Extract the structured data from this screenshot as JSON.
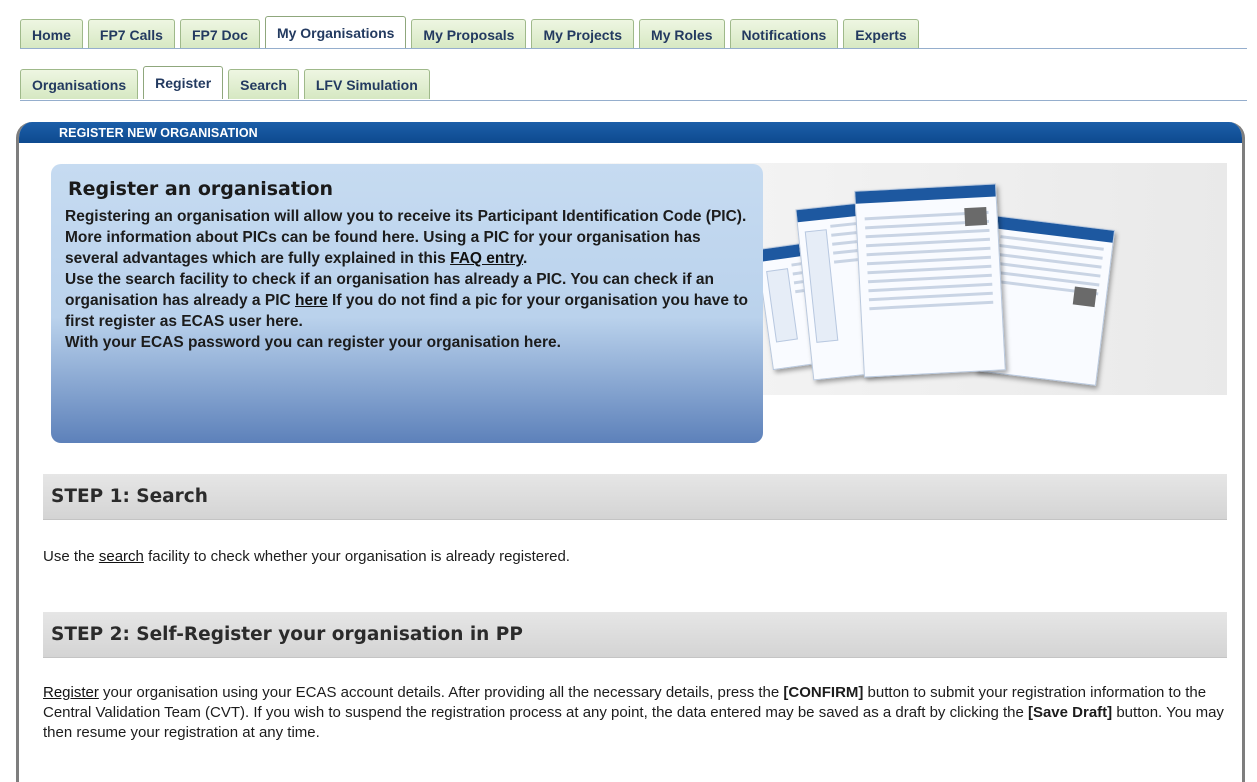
{
  "tabs": [
    "Home",
    "FP7 Calls",
    "FP7 Doc",
    "My Organisations",
    "My Proposals",
    "My Projects",
    "My Roles",
    "Notifications",
    "Experts"
  ],
  "subtabs": [
    "Organisations",
    "Register",
    "Search",
    "LFV Simulation"
  ],
  "panel": {
    "header": "REGISTER NEW ORGANISATION"
  },
  "infobox": {
    "title": "Register an organisation",
    "p1": "Registering an organisation will allow you to receive its Participant Identification Code (PIC).",
    "p2_pre": "More information about PICs can be found here. Using a PIC for your organisation has several advantages which are fully explained in this ",
    "p2_link": "FAQ entry",
    "p2_post": ".",
    "p3_pre": "Use the search facility to check if an organisation has already a PIC. You can check if an organisation has already a PIC ",
    "p3_link": "here",
    "p3_post": " If you do not find a pic for your organisation you have to first register as ECAS user here.",
    "p4": "With your ECAS password you can register your organisation here."
  },
  "step1": {
    "title": "STEP 1: Search",
    "pre": "Use the ",
    "link": "search",
    "post": " facility to check whether your organisation is already registered."
  },
  "step2": {
    "title": "STEP 2: Self-Register your organisation in PP",
    "link": "Register",
    "t1": " your organisation using your ECAS account details. After providing all the necessary details, press the ",
    "b1": "[CONFIRM]",
    "t2": " button to submit your registration information to the Central Validation Team (CVT). If you wish to suspend the registration process at any point, the data entered may be saved as a draft by clicking the ",
    "b2": "[Save Draft]",
    "t3": " button. You may then resume your registration at any time."
  }
}
